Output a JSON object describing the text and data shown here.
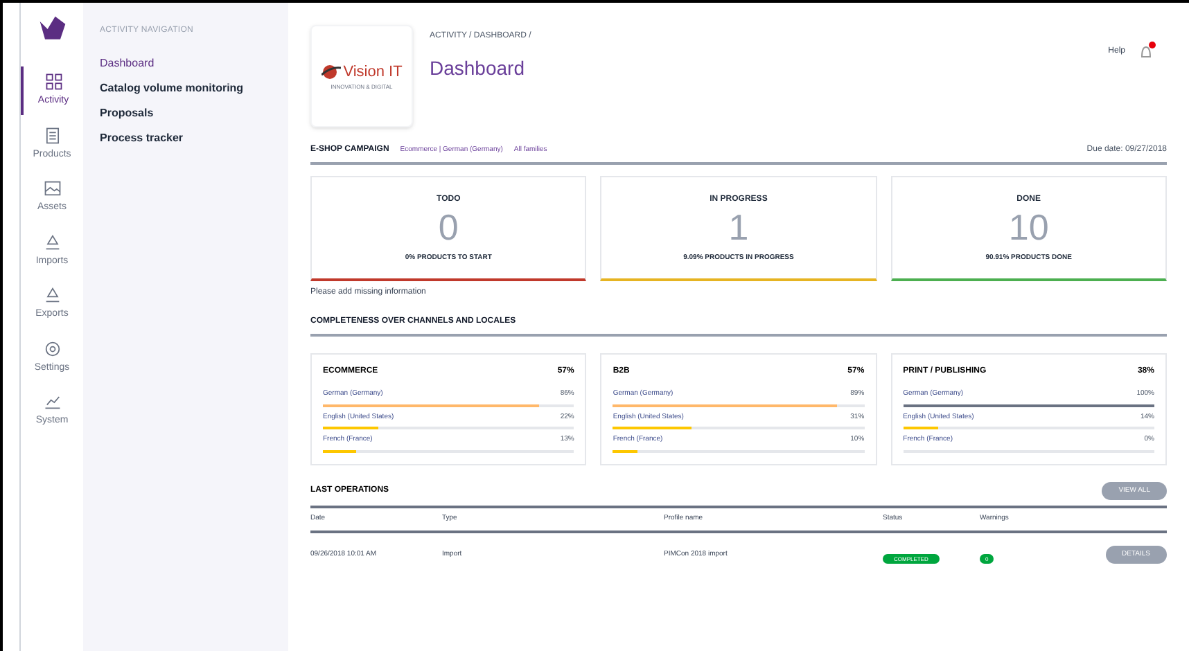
{
  "nav": [
    {
      "label": "Activity",
      "selected": true
    },
    {
      "label": "Products",
      "selected": false
    },
    {
      "label": "Assets",
      "selected": false
    },
    {
      "label": "Imports",
      "selected": false
    },
    {
      "label": "Exports",
      "selected": false
    },
    {
      "label": "Settings",
      "selected": false
    },
    {
      "label": "System",
      "selected": false
    }
  ],
  "submenu": {
    "title": "ACTIVITY NAVIGATION",
    "items": [
      {
        "label": "Dashboard",
        "selected": true
      },
      {
        "label": "Catalog volume monitoring",
        "selected": false
      },
      {
        "label": "Proposals",
        "selected": false
      },
      {
        "label": "Process tracker",
        "selected": false
      }
    ]
  },
  "header": {
    "breadcrumb": "ACTIVITY / DASHBOARD /",
    "title": "Dashboard",
    "logo": {
      "name": "Vision IT",
      "tagline": "INNOVATION & DIGITAL"
    },
    "user": "Help",
    "notification": true
  },
  "campaign": {
    "title": "E-SHOP CAMPAIGN",
    "scope": "Ecommerce | German (Germany)",
    "families": "All families",
    "due": "Due date: 09/27/2018"
  },
  "status_cards": [
    {
      "title": "TODO",
      "count": "0",
      "caption": "0% PRODUCTS TO START",
      "color": "#c0392b"
    },
    {
      "title": "IN PROGRESS",
      "count": "1",
      "caption": "9.09% PRODUCTS IN PROGRESS",
      "color": "#e6b422"
    },
    {
      "title": "DONE",
      "count": "10",
      "caption": "90.91% PRODUCTS DONE",
      "color": "#4caf50"
    }
  ],
  "notice": "Please add missing information",
  "completeness": {
    "title": "COMPLETENESS OVER CHANNELS AND LOCALES",
    "channels": [
      {
        "name": "ECOMMERCE",
        "percent": "57%",
        "locales": [
          {
            "name": "German (Germany)",
            "percent": "86%",
            "level": 0.86
          },
          {
            "name": "English (United States)",
            "percent": "22%",
            "level": 0.22
          },
          {
            "name": "French (France)",
            "percent": "13%",
            "level": 0.13
          }
        ]
      },
      {
        "name": "B2B",
        "percent": "57%",
        "locales": [
          {
            "name": "German (Germany)",
            "percent": "89%",
            "level": 0.89
          },
          {
            "name": "English (United States)",
            "percent": "31%",
            "level": 0.31
          },
          {
            "name": "French (France)",
            "percent": "10%",
            "level": 0.1
          }
        ]
      },
      {
        "name": "PRINT / PUBLISHING",
        "percent": "38%",
        "locales": [
          {
            "name": "German (Germany)",
            "percent": "100%",
            "level": 1
          },
          {
            "name": "English (United States)",
            "percent": "14%",
            "level": 0.14
          },
          {
            "name": "French (France)",
            "percent": "0%",
            "level": 0
          }
        ]
      }
    ]
  },
  "operations": {
    "title": "LAST OPERATIONS",
    "view_all": "VIEW ALL",
    "columns": [
      "Date",
      "Type",
      "Profile name",
      "Status",
      "Warnings"
    ],
    "rows": [
      {
        "date": "09/26/2018 10:01 AM",
        "type": "Import",
        "profile": "PIMCon 2018 import",
        "status": "COMPLETED",
        "warnings": "0",
        "action": "DETAILS"
      }
    ]
  }
}
